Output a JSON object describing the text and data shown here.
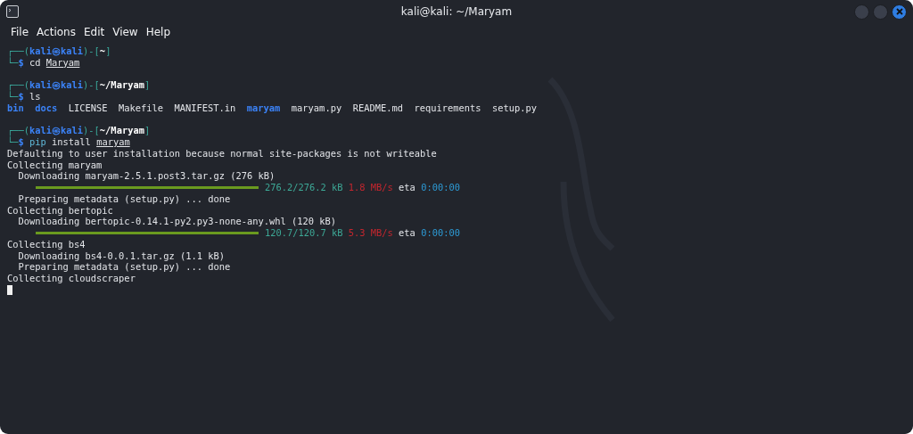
{
  "window": {
    "title": "kali@kali: ~/Maryam"
  },
  "menu": [
    "File",
    "Actions",
    "Edit",
    "View",
    "Help"
  ],
  "terminal": {
    "blocks": [
      [
        [
          {
            "kind": "frame",
            "text": "┌──("
          },
          {
            "kind": "user",
            "text": "kali㉿kali"
          },
          {
            "kind": "frame",
            "text": ")-["
          },
          {
            "kind": "path",
            "text": "~"
          },
          {
            "kind": "frame",
            "text": "]"
          }
        ],
        [
          {
            "kind": "frame",
            "text": "└─"
          },
          {
            "kind": "dollar",
            "text": "$ "
          },
          {
            "kind": "plain",
            "text": "cd "
          },
          {
            "kind": "arg",
            "text": "Maryam"
          }
        ]
      ],
      [
        [
          {
            "kind": "frame",
            "text": "┌──("
          },
          {
            "kind": "user",
            "text": "kali㉿kali"
          },
          {
            "kind": "frame",
            "text": ")-["
          },
          {
            "kind": "path",
            "text": "~/Maryam"
          },
          {
            "kind": "frame",
            "text": "]"
          }
        ],
        [
          {
            "kind": "frame",
            "text": "└─"
          },
          {
            "kind": "dollar",
            "text": "$ "
          },
          {
            "kind": "plain",
            "text": "ls"
          }
        ],
        [
          {
            "kind": "dir",
            "text": "bin"
          },
          {
            "kind": "dir",
            "text": "docs"
          },
          {
            "kind": "file",
            "text": "LICENSE"
          },
          {
            "kind": "file",
            "text": "Makefile"
          },
          {
            "kind": "file",
            "text": "MANIFEST.in"
          },
          {
            "kind": "dir",
            "text": "maryam"
          },
          {
            "kind": "file",
            "text": "maryam.py"
          },
          {
            "kind": "file",
            "text": "README.md"
          },
          {
            "kind": "file",
            "text": "requirements"
          },
          {
            "kind": "file",
            "text": "setup.py"
          }
        ]
      ],
      [
        [
          {
            "kind": "frame",
            "text": "┌──("
          },
          {
            "kind": "user",
            "text": "kali㉿kali"
          },
          {
            "kind": "frame",
            "text": ")-["
          },
          {
            "kind": "path",
            "text": "~/Maryam"
          },
          {
            "kind": "frame",
            "text": "]"
          }
        ],
        [
          {
            "kind": "frame",
            "text": "└─"
          },
          {
            "kind": "dollar",
            "text": "$ "
          },
          {
            "kind": "cmd",
            "text": "pip"
          },
          {
            "kind": "plain",
            "text": " install "
          },
          {
            "kind": "arg",
            "text": "maryam"
          }
        ],
        [
          {
            "kind": "plain",
            "text": "Defaulting to user installation because normal site-packages is not writeable"
          }
        ],
        [
          {
            "kind": "plain",
            "text": "Collecting maryam"
          }
        ],
        [
          {
            "kind": "plain",
            "text": "  Downloading maryam-2.5.1.post3.tar.gz (276 kB)"
          }
        ],
        [
          {
            "kind": "bar",
            "level": 1
          },
          {
            "kind": "size",
            "text": "276.2/276.2 kB"
          },
          {
            "kind": "speed",
            "text": "1.8 MB/s"
          },
          {
            "kind": "plain",
            "text": "eta"
          },
          {
            "kind": "eta",
            "text": "0:00:00"
          }
        ],
        [
          {
            "kind": "plain",
            "text": "  Preparing metadata (setup.py) ... done"
          }
        ],
        [
          {
            "kind": "plain",
            "text": "Collecting bertopic"
          }
        ],
        [
          {
            "kind": "plain",
            "text": "  Downloading bertopic-0.14.1-py2.py3-none-any.whl (120 kB)"
          }
        ],
        [
          {
            "kind": "bar",
            "level": 1
          },
          {
            "kind": "size",
            "text": "120.7/120.7 kB"
          },
          {
            "kind": "speed",
            "text": "5.3 MB/s"
          },
          {
            "kind": "plain",
            "text": "eta"
          },
          {
            "kind": "eta",
            "text": "0:00:00"
          }
        ],
        [
          {
            "kind": "plain",
            "text": "Collecting bs4"
          }
        ],
        [
          {
            "kind": "plain",
            "text": "  Downloading bs4-0.0.1.tar.gz (1.1 kB)"
          }
        ],
        [
          {
            "kind": "plain",
            "text": "  Preparing metadata (setup.py) ... done"
          }
        ],
        [
          {
            "kind": "plain",
            "text": "Collecting cloudscraper"
          }
        ]
      ]
    ]
  }
}
